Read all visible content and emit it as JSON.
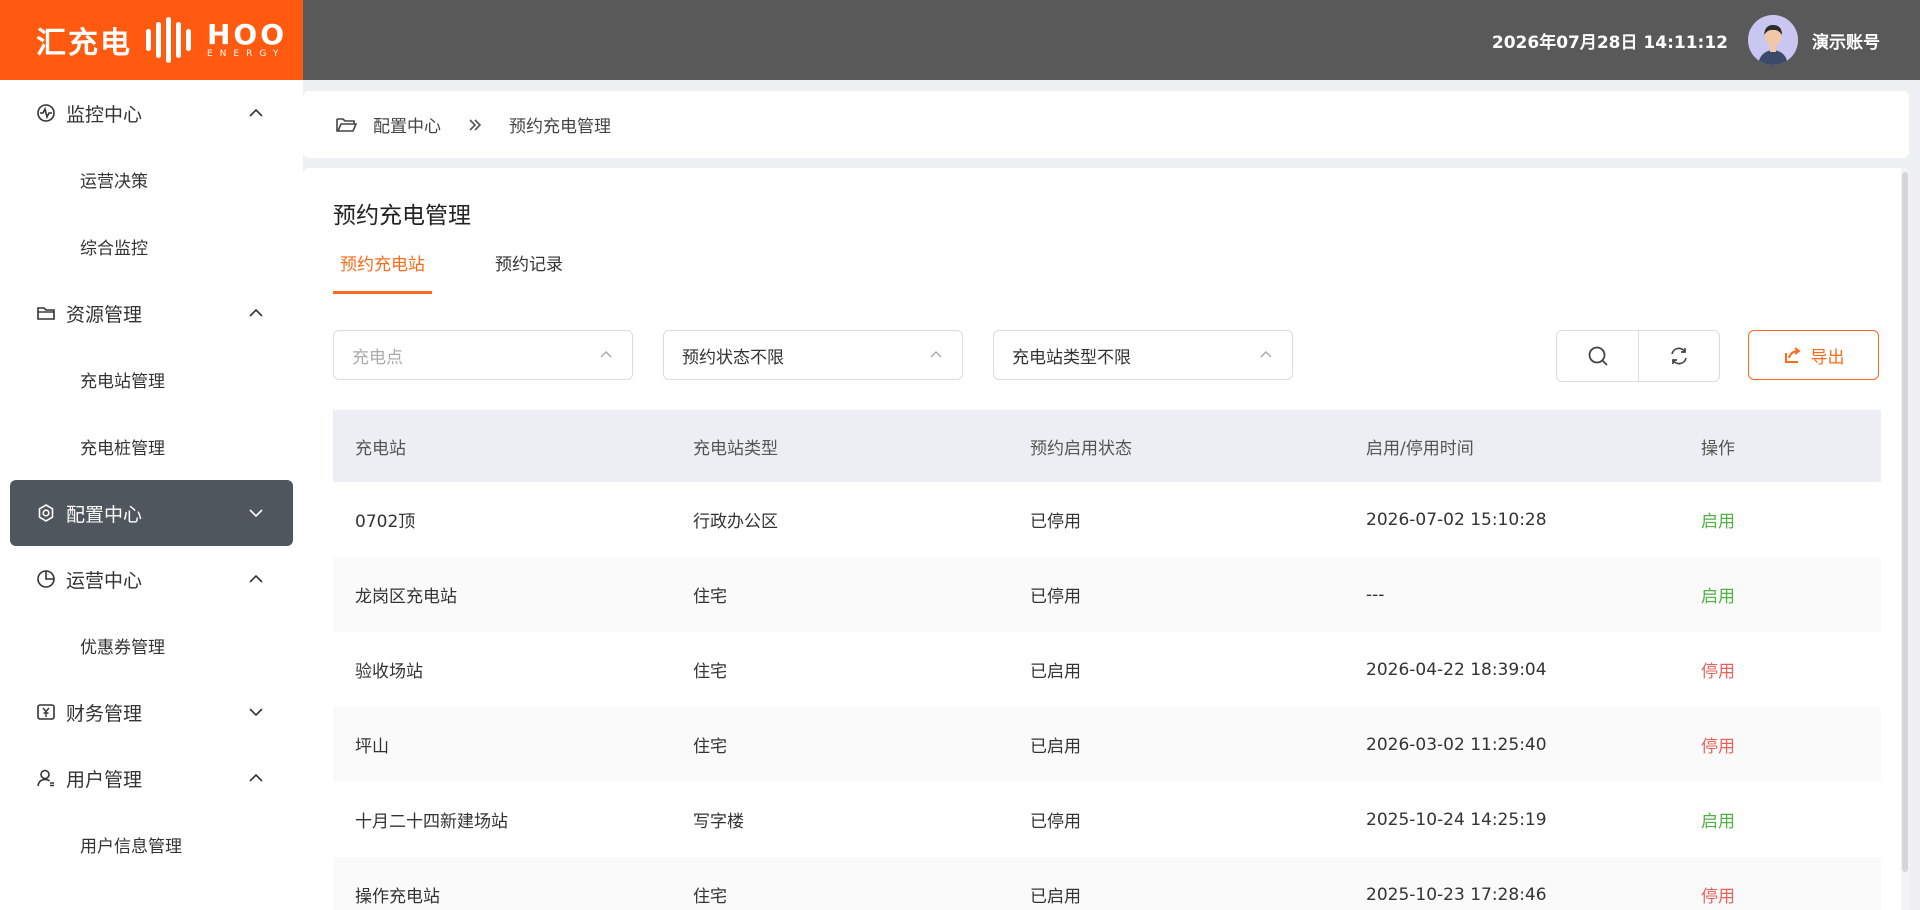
{
  "header": {
    "logo_cn": "汇充电",
    "logo_en": "HOO",
    "logo_en_sub": "ENERGY",
    "datetime": "2026年07月28日 14:11:12",
    "username": "演示账号"
  },
  "sidebar": {
    "groups": [
      {
        "label": "监控中心",
        "icon": "monitor-pulse-icon",
        "expanded": true,
        "items": [
          "运营决策",
          "综合监控"
        ]
      },
      {
        "label": "资源管理",
        "icon": "folder-icon",
        "expanded": true,
        "items": [
          "充电站管理",
          "充电桩管理"
        ]
      },
      {
        "label": "配置中心",
        "icon": "gear-icon",
        "expanded": false,
        "active": true,
        "items": []
      },
      {
        "label": "运营中心",
        "icon": "pie-chart-icon",
        "expanded": true,
        "items": [
          "优惠券管理"
        ]
      },
      {
        "label": "财务管理",
        "icon": "finance-icon",
        "expanded": false,
        "items": []
      },
      {
        "label": "用户管理",
        "icon": "user-icon",
        "expanded": true,
        "items": [
          "用户信息管理"
        ]
      }
    ]
  },
  "breadcrumb": {
    "parent": "配置中心",
    "current": "预约充电管理"
  },
  "page": {
    "title": "预约充电管理",
    "tabs": [
      {
        "label": "预约充电站",
        "active": true
      },
      {
        "label": "预约记录",
        "active": false
      }
    ]
  },
  "filters": {
    "station_placeholder": "充电点",
    "status_value": "预约状态不限",
    "type_value": "充电站类型不限"
  },
  "toolbar": {
    "export_label": "导出"
  },
  "table": {
    "headers": [
      "充电站",
      "充电站类型",
      "预约启用状态",
      "启用/停用时间",
      "操作"
    ],
    "rows": [
      {
        "station": "0702顶",
        "type": "行政办公区",
        "status": "已停用",
        "time": "2026-07-02 15:10:28",
        "action": "启用"
      },
      {
        "station": "龙岗区充电站",
        "type": "住宅",
        "status": "已停用",
        "time": "---",
        "action": "启用"
      },
      {
        "station": "验收场站",
        "type": "住宅",
        "status": "已启用",
        "time": "2026-04-22 18:39:04",
        "action": "停用"
      },
      {
        "station": "坪山",
        "type": "住宅",
        "status": "已启用",
        "time": "2026-03-02 11:25:40",
        "action": "停用"
      },
      {
        "station": "十月二十四新建场站",
        "type": "写字楼",
        "status": "已停用",
        "time": "2025-10-24 14:25:19",
        "action": "启用"
      },
      {
        "station": "操作充电站",
        "type": "住宅",
        "status": "已启用",
        "time": "2025-10-23 17:28:46",
        "action": "停用"
      }
    ]
  },
  "colors": {
    "accent": "#ff6a1a",
    "enable": "#52b043",
    "disable": "#e8625a"
  }
}
